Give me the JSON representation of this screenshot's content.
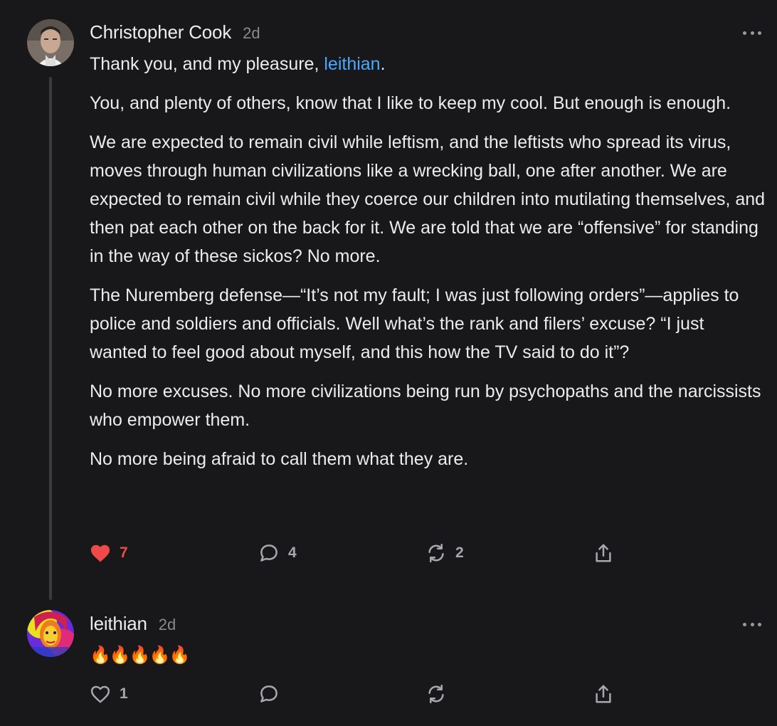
{
  "comments": [
    {
      "author": "Christopher Cook",
      "time": "2d",
      "intro": "Thank you, and my pleasure, ",
      "mention": "leithian",
      "intro_end": ".",
      "paragraphs": [
        "You, and plenty of others, know that I like to keep my cool. But enough is enough.",
        "We are expected to remain civil while leftism, and the leftists who spread its virus, moves through human civilizations like a wrecking ball, one after another. We are expected to remain civil while they coerce our children into mutilating themselves, and then pat each other on the back for it. We are told that we are “offensive” for standing in the way of these sickos? No more.",
        "The Nuremberg defense—“It’s not my fault; I was just following orders”—applies to police and soldiers and officials. Well what’s the rank and filers’ excuse? “I just wanted to feel good about myself, and this how the TV said to do it”?",
        "No more excuses. No more civilizations being run by psychopaths and the narcissists who empower them.",
        "No more being afraid to call them what they are."
      ],
      "likes": "7",
      "replies": "4",
      "restacks": "2",
      "liked": true
    },
    {
      "author": "leithian",
      "time": "2d",
      "text": "🔥🔥🔥🔥🔥",
      "likes": "1",
      "replies": "",
      "restacks": "",
      "liked": false
    }
  ],
  "colors": {
    "background": "#18181a",
    "like_active": "#ef4a4a",
    "mention": "#4aa8ff",
    "muted": "#8a8a8e"
  },
  "icons": {
    "like": "heart-icon",
    "reply": "speech-bubble-icon",
    "restack": "restack-arrows-icon",
    "share": "share-icon",
    "more": "more-dots-icon"
  }
}
